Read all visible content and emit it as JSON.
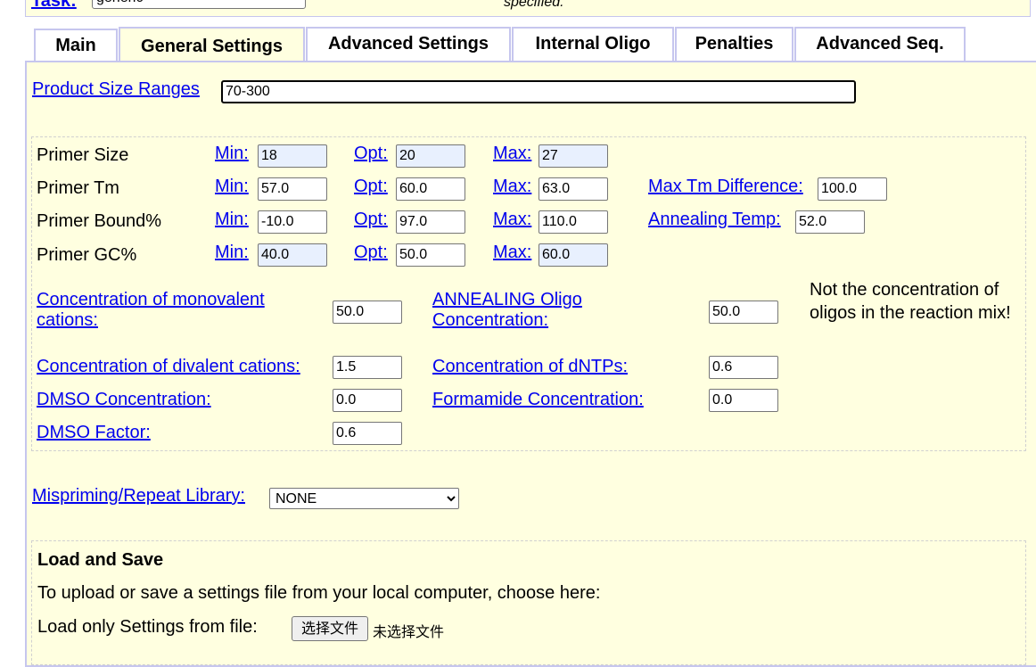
{
  "header": {
    "task_label": "Task:",
    "task_value": "generic",
    "note": "specified."
  },
  "tabs": [
    {
      "label": "Main"
    },
    {
      "label": "General Settings"
    },
    {
      "label": "Advanced Settings"
    },
    {
      "label": "Internal Oligo"
    },
    {
      "label": "Penalties"
    },
    {
      "label": "Advanced Seq."
    }
  ],
  "product_size": {
    "label": "Product Size Ranges",
    "value": "70-300"
  },
  "primer": {
    "min_label": "Min:",
    "opt_label": "Opt:",
    "max_label": "Max:",
    "size": {
      "label": "Primer Size",
      "min": "18",
      "opt": "20",
      "max": "27"
    },
    "tm": {
      "label": "Primer Tm",
      "min": "57.0",
      "opt": "60.0",
      "max": "63.0",
      "extra_label": "Max Tm Difference:",
      "extra_value": "100.0"
    },
    "bound": {
      "label": "Primer Bound%",
      "min": "-10.0",
      "opt": "97.0",
      "max": "110.0",
      "extra_label": "Annealing Temp:",
      "extra_value": "52.0"
    },
    "gc": {
      "label": "Primer GC%",
      "min": "40.0",
      "opt": "50.0",
      "max": "60.0"
    }
  },
  "conc": {
    "mono_label_1": "Concentration of monovalent",
    "mono_label_2": "cations:",
    "mono_value": "50.0",
    "anneal_label_1": "ANNEALING Oligo",
    "anneal_label_2": "Concentration:",
    "anneal_value": "50.0",
    "anneal_note": "Not the concentration of oligos in the reaction mix!",
    "div_label": "Concentration of divalent cations:",
    "div_value": "1.5",
    "dntp_label": "Concentration of dNTPs:",
    "dntp_value": "0.6",
    "dmso_label": "DMSO Concentration:",
    "dmso_value": "0.0",
    "formamide_label": "Formamide Concentration:",
    "formamide_value": "0.0",
    "dmso_factor_label": "DMSO Factor:",
    "dmso_factor_value": "0.6"
  },
  "mispriming": {
    "label": "Mispriming/Repeat Library:",
    "value": "NONE"
  },
  "load_save": {
    "title": "Load and Save",
    "desc": "To upload or save a settings file from your local computer, choose here:",
    "load_label": "Load only Settings from file:",
    "button_label": "选择文件",
    "no_file": "未选择文件"
  }
}
